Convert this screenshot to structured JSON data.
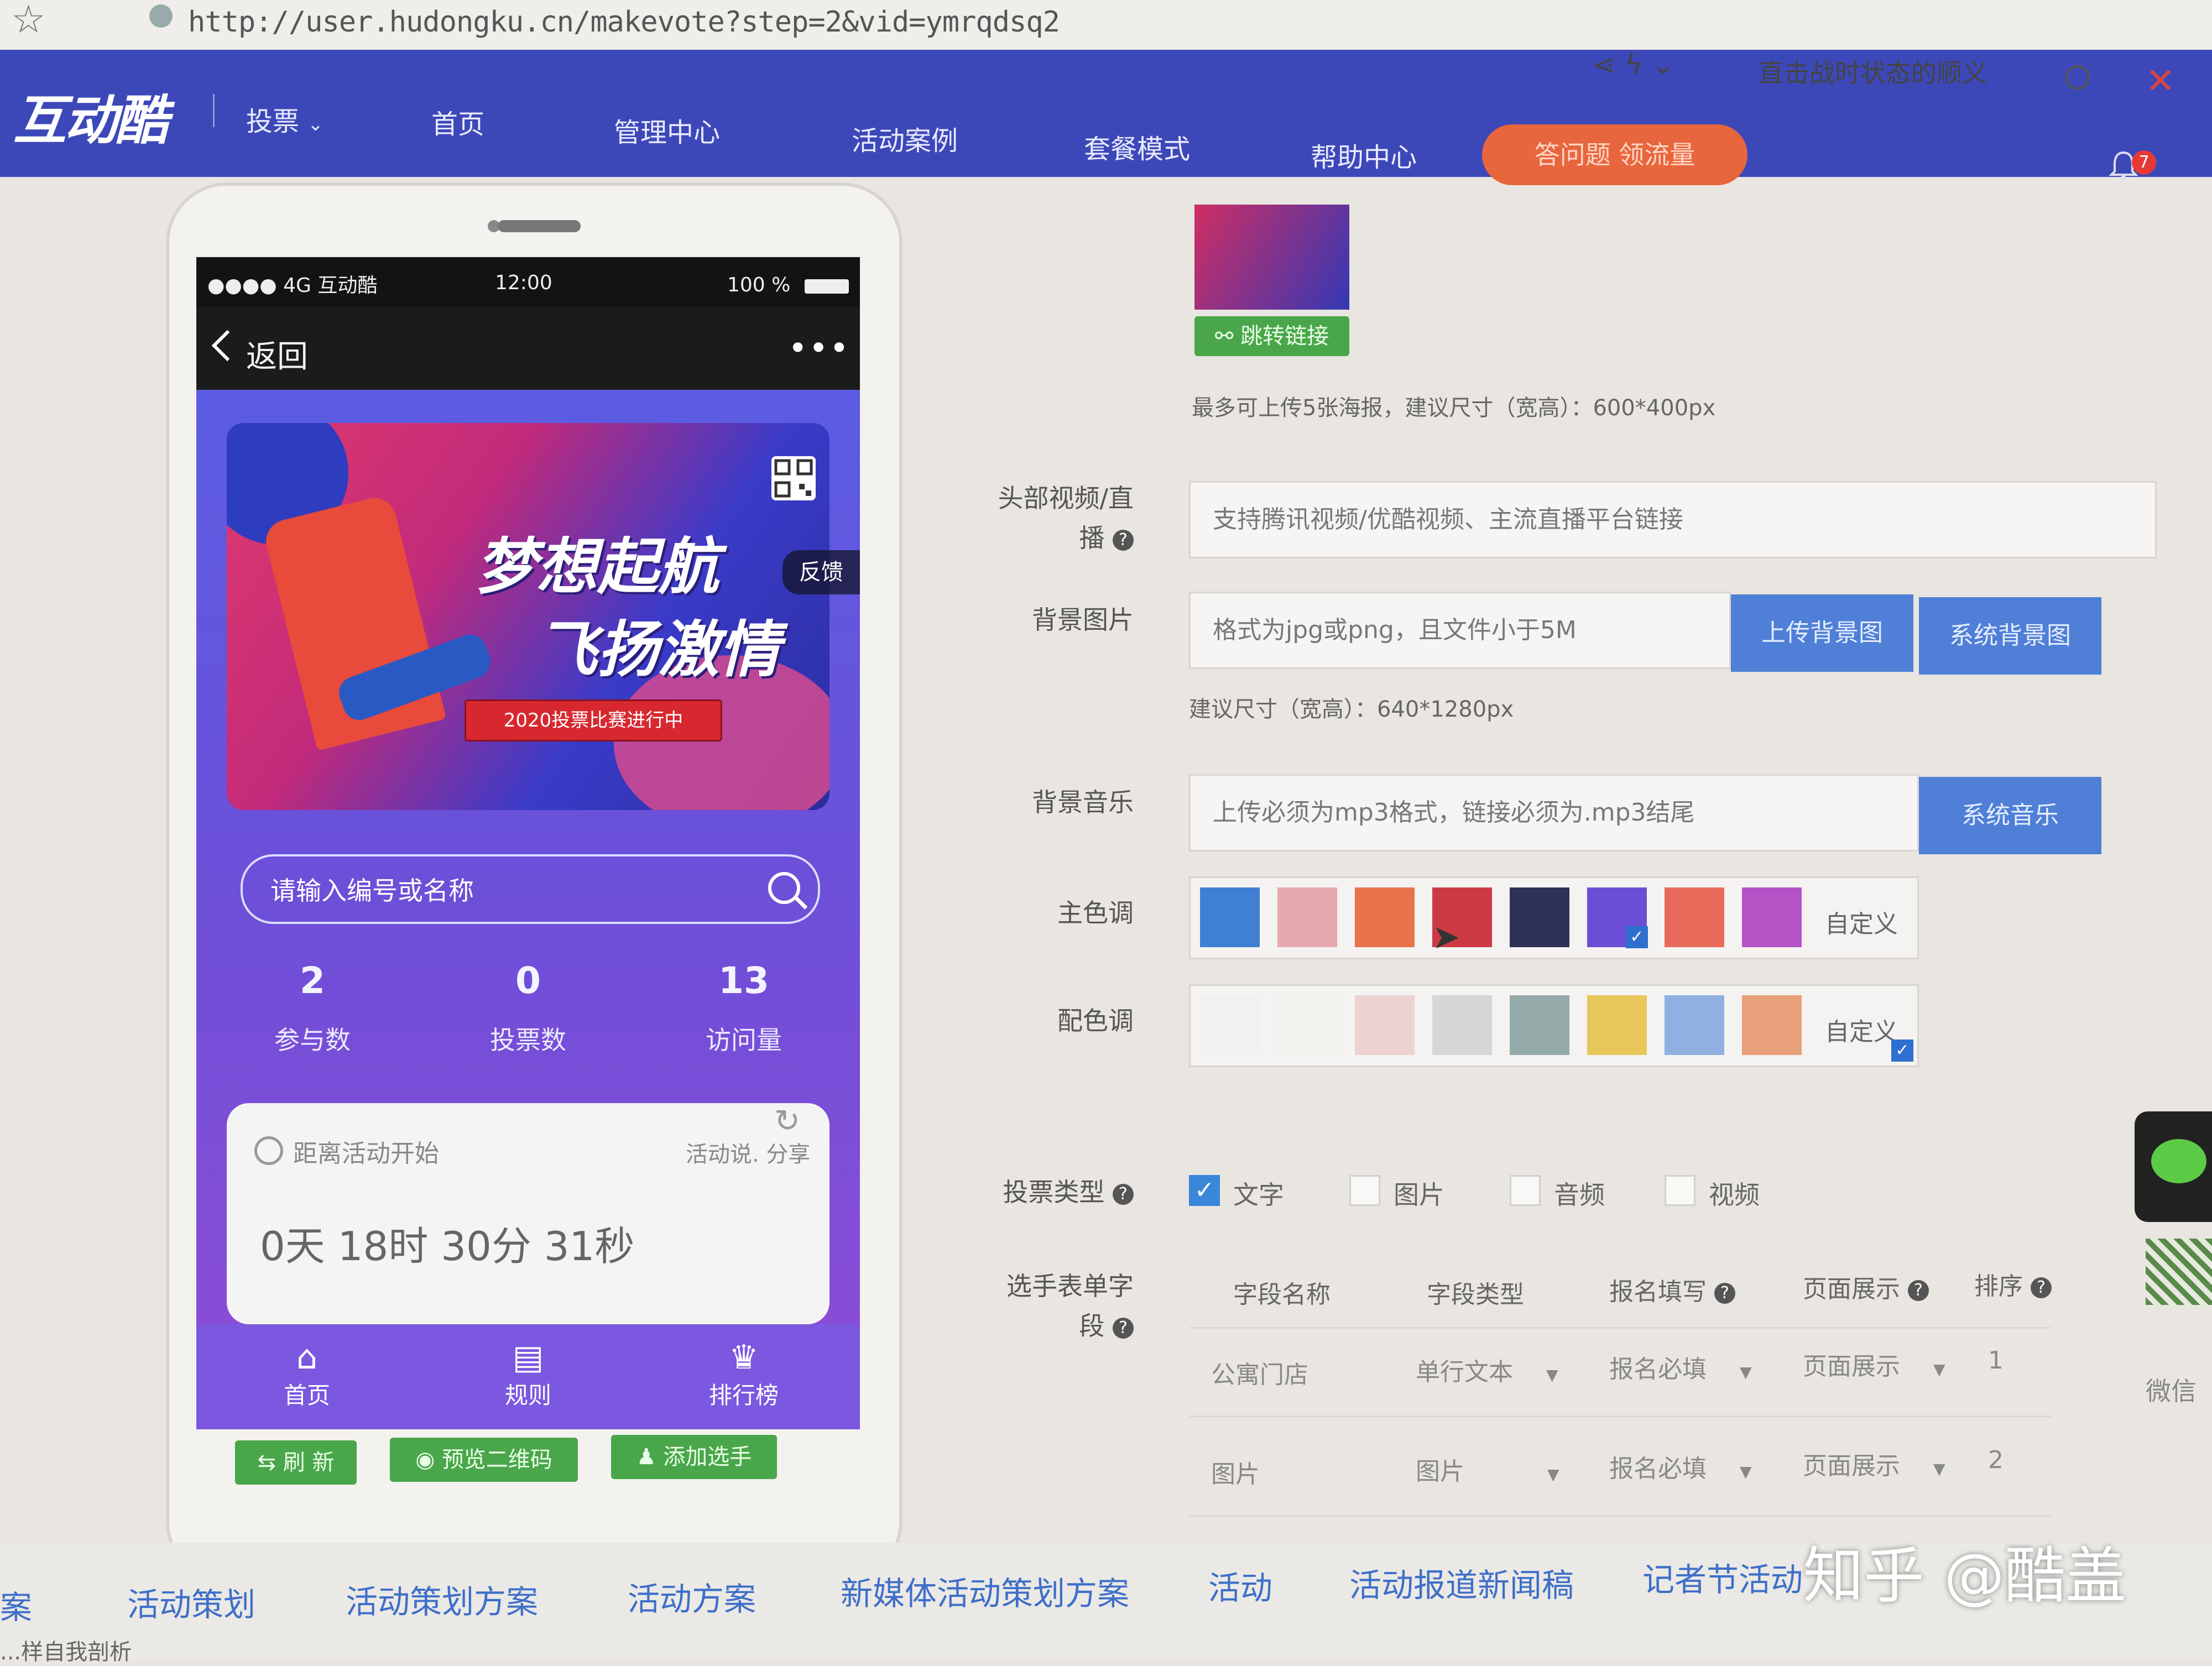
{
  "browser": {
    "url": "http://user.hudongku.cn/makevote?step=2&vid=ymrqdsq2",
    "tab_text": "直击战时状态的顺义"
  },
  "nav": {
    "logo": "互动酷",
    "vote_menu": "投票",
    "items": [
      "首页",
      "管理中心",
      "活动案例",
      "套餐模式",
      "帮助中心"
    ],
    "promo": "答问题 领流量",
    "bell_count": "7"
  },
  "phone": {
    "status": {
      "signal": "●●●● 4G 互动酷",
      "time": "12:00",
      "battery": "100 %"
    },
    "back": "返回",
    "more": "•••",
    "banner": {
      "title1": "梦想起航",
      "title2": "飞扬激情",
      "tag": "2020投票比赛进行中"
    },
    "feedback": "反馈",
    "search_placeholder": "请输入编号或名称",
    "stats": [
      {
        "value": "2",
        "label": "参与数"
      },
      {
        "value": "0",
        "label": "投票数"
      },
      {
        "value": "13",
        "label": "访问量"
      }
    ],
    "countdown_label": "距离活动开始",
    "countdown_right": "活动说. 分享",
    "countdown": "0天 18时 30分 31秒",
    "tabs": [
      {
        "icon": "⌂",
        "label": "首页"
      },
      {
        "icon": "▤",
        "label": "规则"
      },
      {
        "icon": "♛",
        "label": "排行榜"
      }
    ]
  },
  "actions": {
    "refresh": "刷 新",
    "preview_qr": "预览二维码",
    "add_player": "添加选手"
  },
  "form": {
    "jump_link": "跳转链接",
    "poster_hint": "最多可上传5张海报，建议尺寸（宽高）：600*400px",
    "video_label_1": "头部视频/直",
    "video_label_2": "播",
    "video_placeholder": "支持腾讯视频/优酷视频、主流直播平台链接",
    "bg_label": "背景图片",
    "bg_placeholder": "格式为jpg或png，且文件小于5M",
    "bg_upload": "上传背景图",
    "bg_system": "系统背景图",
    "bg_hint": "建议尺寸（宽高）：640*1280px",
    "music_label": "背景音乐",
    "music_placeholder": "上传必须为mp3格式，链接必须为.mp3结尾",
    "music_system": "系统音乐",
    "main_color_label": "主色调",
    "main_colors": [
      "#3f7fd4",
      "#e8a8b0",
      "#e8724a",
      "#cc3a44",
      "#2f3157",
      "#6a4fd6",
      "#e86a5a",
      "#b452c6"
    ],
    "accent_color_label": "配色调",
    "accent_colors": [
      "#f1f1f1",
      "#f3f2ef",
      "#ecd3d1",
      "#d6d6d4",
      "#93aaa8",
      "#e8c65a",
      "#8fb0e0",
      "#e8a07a"
    ],
    "custom": "自定义",
    "vote_type_label": "投票类型",
    "vote_types": [
      {
        "label": "文字",
        "checked": true
      },
      {
        "label": "图片",
        "checked": false
      },
      {
        "label": "音频",
        "checked": false
      },
      {
        "label": "视频",
        "checked": false
      }
    ],
    "fields_label_1": "选手表单字",
    "fields_label_2": "段",
    "table_headers": [
      "字段名称",
      "字段类型",
      "报名填写",
      "页面展示",
      "排序"
    ],
    "table_rows": [
      [
        "公寓门店",
        "单行文本",
        "报名必填",
        "页面展示",
        "1"
      ],
      [
        "图片",
        "图片",
        "报名必填",
        "页面展示",
        "2"
      ]
    ]
  },
  "bottom_links": [
    "案",
    "活动策划",
    "活动策划方案",
    "活动方案",
    "新媒体活动策划方案",
    "活动",
    "活动报道新闻稿",
    "记者节活动"
  ],
  "bottom_sub": "...样自我剖析",
  "watermark": "知乎 @酷盖",
  "side_text": "微信"
}
